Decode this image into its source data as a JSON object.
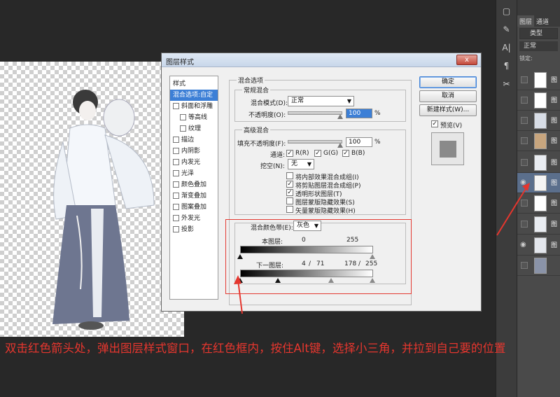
{
  "dialog": {
    "title": "图层样式",
    "close": "x",
    "styles_header": "样式",
    "styles": [
      {
        "label": "混合选项:自定",
        "checkbox": false,
        "selected": true,
        "indent": false
      },
      {
        "label": "斜面和浮雕",
        "checkbox": true,
        "selected": false,
        "indent": false
      },
      {
        "label": "等高线",
        "checkbox": true,
        "selected": false,
        "indent": true
      },
      {
        "label": "纹理",
        "checkbox": true,
        "selected": false,
        "indent": true
      },
      {
        "label": "描边",
        "checkbox": true,
        "selected": false,
        "indent": false
      },
      {
        "label": "内阴影",
        "checkbox": true,
        "selected": false,
        "indent": false
      },
      {
        "label": "内发光",
        "checkbox": true,
        "selected": false,
        "indent": false
      },
      {
        "label": "光泽",
        "checkbox": true,
        "selected": false,
        "indent": false
      },
      {
        "label": "颜色叠加",
        "checkbox": true,
        "selected": false,
        "indent": false
      },
      {
        "label": "渐变叠加",
        "checkbox": true,
        "selected": false,
        "indent": false
      },
      {
        "label": "图案叠加",
        "checkbox": true,
        "selected": false,
        "indent": false
      },
      {
        "label": "外发光",
        "checkbox": true,
        "selected": false,
        "indent": false
      },
      {
        "label": "投影",
        "checkbox": true,
        "selected": false,
        "indent": false
      }
    ],
    "blend_options": {
      "title": "混合选项",
      "general": {
        "title": "常规混合",
        "mode_label": "混合模式(D):",
        "mode_value": "正常",
        "opacity_label": "不透明度(O):",
        "opacity_value": "100",
        "percent": "%"
      },
      "advanced": {
        "title": "高级混合",
        "fill_label": "填充不透明度(F):",
        "fill_value": "100",
        "percent": "%",
        "channels_label": "通道:",
        "channel_r": "R(R)",
        "channel_g": "G(G)",
        "channel_b": "B(B)",
        "knockout_label": "挖空(N):",
        "knockout_value": "无",
        "options": [
          {
            "label": "将内部效果混合成组(I)",
            "checked": false
          },
          {
            "label": "将剪贴图层混合成组(P)",
            "checked": true
          },
          {
            "label": "透明形状图层(T)",
            "checked": true
          },
          {
            "label": "图层蒙版隐藏效果(S)",
            "checked": false
          },
          {
            "label": "矢量蒙版隐藏效果(H)",
            "checked": false
          }
        ]
      },
      "blend_if": {
        "label": "混合颜色带(E):",
        "value": "灰色",
        "this_layer": "本图层:",
        "this_low": "0",
        "this_high": "255",
        "underlying": "下一图层:",
        "under_low": "4",
        "under_low_split": "71",
        "under_high": "178",
        "under_high_split": "255",
        "slash": "/"
      }
    },
    "buttons": {
      "ok": "确定",
      "cancel": "取消",
      "new_style": "新建样式(W)...",
      "preview": "预览(V)"
    }
  },
  "layers_panel": {
    "tab_layers": "图层",
    "tab_channels": "通道",
    "kind": "类型",
    "blend_mode": "正常",
    "lock": "锁定:",
    "layer_name": "图"
  },
  "caption": "双击红色箭头处，弹出图层样式窗口，在红色框内，按住Alt键，选择小三角，并拉到自己要的位置",
  "colors": {
    "annotation_red": "#e6362e",
    "selection_blue": "#3c7fd6",
    "panel_dark": "#4a4a4a"
  }
}
